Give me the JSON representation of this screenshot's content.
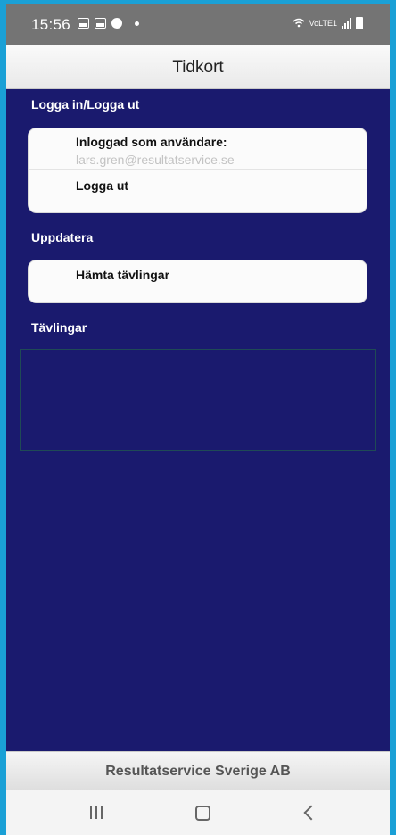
{
  "status_bar": {
    "time": "15:56",
    "network_label": "VoLTE1"
  },
  "header": {
    "title": "Tidkort"
  },
  "sections": {
    "login": {
      "label": "Logga in/Logga ut",
      "logged_in_title": "Inloggad som användare:",
      "logged_in_user": "lars.gren@resultatservice.se",
      "logout_label": "Logga ut"
    },
    "update": {
      "label": "Uppdatera",
      "fetch_label": "Hämta tävlingar"
    },
    "competitions": {
      "label": "Tävlingar",
      "items": []
    }
  },
  "footer": {
    "text": "Resultatservice Sverige AB"
  },
  "colors": {
    "main_background": "#1a1a6e",
    "frame": "#1aa0d6",
    "status_bar": "#747474"
  }
}
